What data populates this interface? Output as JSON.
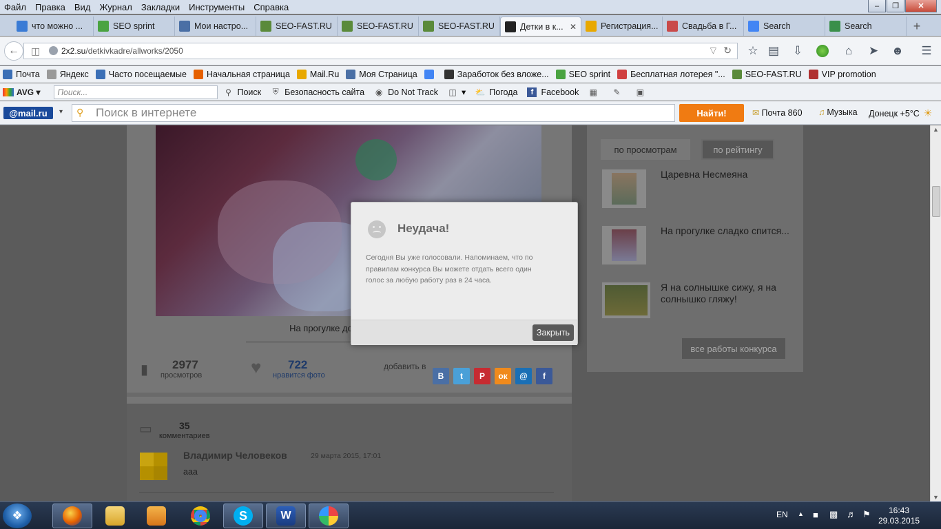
{
  "menubar": {
    "items": [
      "Файл",
      "Правка",
      "Вид",
      "Журнал",
      "Закладки",
      "Инструменты",
      "Справка"
    ]
  },
  "tabs": [
    {
      "label": "что можно ...",
      "icon": "search-icon",
      "color": "#3a7bd5"
    },
    {
      "label": "SEO sprint",
      "icon": "seosprint-icon",
      "color": "#4aa341"
    },
    {
      "label": "Мои настро...",
      "icon": "vk-icon",
      "color": "#4a6fa5"
    },
    {
      "label": "SEO-FAST.RU",
      "icon": "sf-icon",
      "color": "#5a8a3a"
    },
    {
      "label": "SEO-FAST.RU",
      "icon": "sf-icon",
      "color": "#5a8a3a"
    },
    {
      "label": "SEO-FAST.RU",
      "icon": "sf-icon",
      "color": "#5a8a3a"
    },
    {
      "label": "Детки в к...",
      "icon": "2x2-icon",
      "color": "#222222",
      "active": true
    },
    {
      "label": "Регистрация...",
      "icon": "mailru-icon",
      "color": "#e8a800"
    },
    {
      "label": "Свадьба в Г...",
      "icon": "wedding-icon",
      "color": "#c94a4a"
    },
    {
      "label": "Search",
      "icon": "google-icon",
      "color": "#4285f4"
    },
    {
      "label": "Search",
      "icon": "search-page-icon",
      "color": "#3a8f4a"
    }
  ],
  "newtab": "+",
  "url": {
    "domain": "2x2.su",
    "path": "/detkivkadre/allworks/2050"
  },
  "bookmarks": [
    {
      "label": "Почта",
      "icon": "mail-icon",
      "color": "#3b6fb6"
    },
    {
      "label": "Яндекс",
      "icon": "page-icon",
      "color": "#999999"
    },
    {
      "label": "Часто посещаемые",
      "icon": "frequent-icon",
      "color": "#3b6fb6"
    },
    {
      "label": "Начальная страница",
      "icon": "firefox-icon",
      "color": "#e66000"
    },
    {
      "label": "Mail.Ru",
      "icon": "mailru-icon",
      "color": "#e8a800"
    },
    {
      "label": "Моя Страница",
      "icon": "vk-icon",
      "color": "#4a6fa5"
    },
    {
      "label": "",
      "icon": "google-icon",
      "color": "#4285f4"
    },
    {
      "label": "Заработок без вложе...",
      "icon": "earn-icon",
      "color": "#333333"
    },
    {
      "label": "SEO sprint",
      "icon": "seosprint-icon",
      "color": "#4aa341"
    },
    {
      "label": "Бесплатная лотерея \"...",
      "icon": "lottery-icon",
      "color": "#d04040"
    },
    {
      "label": "SEO-FAST.RU",
      "icon": "sf-icon",
      "color": "#5a8a3a"
    },
    {
      "label": "VIP promotion",
      "icon": "vip-icon",
      "color": "#b03030"
    }
  ],
  "avg": {
    "brand": "AVG",
    "placeholder": "Поиск...",
    "search_label": "Поиск",
    "site_safety": "Безопасность сайта",
    "dnt": "Do Not Track",
    "weather": "Погода",
    "facebook": "Facebook"
  },
  "mailbar": {
    "logo": "@mail.ru",
    "placeholder": "Поиск в интернете",
    "find": "Найти!",
    "mail_label": "Почта 860",
    "music": "Музыка",
    "weather": "Донецк +5°C"
  },
  "post": {
    "caption": "На прогулке дочурка Валери",
    "views": "2977",
    "views_label": "просмотров",
    "likes": "722",
    "likes_label": "нравится фото",
    "share_label": "добавить в",
    "share": [
      {
        "label": "В",
        "color": "#4a6fa5",
        "name": "share-vk-button"
      },
      {
        "label": "t",
        "color": "#4aa0d8",
        "name": "share-twitter-button"
      },
      {
        "label": "P",
        "color": "#c72b31",
        "name": "share-pinterest-button"
      },
      {
        "label": "ок",
        "color": "#f08a1c",
        "name": "share-odnoklassniki-button"
      },
      {
        "label": "@",
        "color": "#1a6fb5",
        "name": "share-mailru-button"
      },
      {
        "label": "f",
        "color": "#3b5998",
        "name": "share-facebook-button"
      }
    ]
  },
  "comments": {
    "count": "35",
    "count_label": "комментариев",
    "author": "Владимир Человеков",
    "date": "29 марта 2015, 17:01",
    "text": "ааа"
  },
  "sidebar": {
    "sort_views": "по просмотрам",
    "sort_rating": "по рейтингу",
    "items": [
      {
        "title": "Царевна Несмеяна"
      },
      {
        "title": "На прогулке сладко спится..."
      },
      {
        "title": "Я на солнышке сижу, я на солнышко гляжу!"
      }
    ],
    "all_works": "все работы конкурса"
  },
  "modal": {
    "title": "Неудача!",
    "message": "Сегодня Вы уже голосовали. Напоминаем, что по правилам конкурса Вы можете отдать всего один голос за любую работу раз в 24 часа.",
    "close": "Закрыть"
  },
  "taskbar": {
    "lang": "EN",
    "time": "16:43",
    "date": "29.03.2015"
  }
}
